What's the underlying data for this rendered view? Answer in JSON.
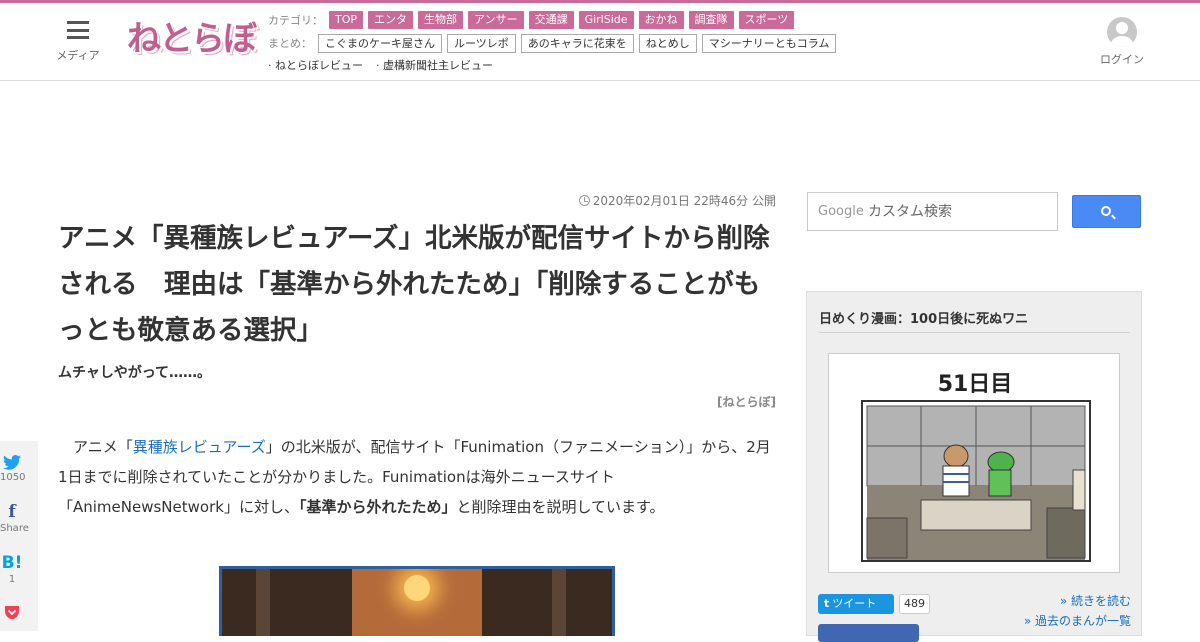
{
  "header": {
    "menu_label": "メディア",
    "logo_text": "ねとらぼ",
    "category_label": "カテゴリ：",
    "categories": [
      "TOP",
      "エンタ",
      "生物部",
      "アンサー",
      "交通課",
      "GirlSide",
      "おかね",
      "調査隊",
      "スポーツ"
    ],
    "summary_label": "まとめ：",
    "summaries": [
      "こぐまのケーキ屋さん",
      "ルーツレポ",
      "あのキャラに花束を",
      "ねとめし",
      "マシーナリーともコラム"
    ],
    "reviews": [
      "· ねとらぼレビュー",
      "· 虚構新聞社主レビュー"
    ],
    "login_label": "ログイン"
  },
  "article": {
    "date": "2020年02月01日 22時46分 公開",
    "title": "アニメ「異種族レビュアーズ」北米版が配信サイトから削除される　理由は「基準から外れたため」「削除することがもっとも敬意ある選択」",
    "subtitle": "ムチャしやがって……。",
    "byline": "[ねとらぼ]",
    "para_pre": "　アニメ「",
    "para_link": "異種族レビュアーズ",
    "para_mid": "」の北米版が、配信サイト「Funimation（ファニメーション）」から、2月1日までに削除されていたことが分かりました。Funimationは海外ニュースサイト「AnimeNewsNetwork」に対し、",
    "para_bold": "「基準から外れたため」",
    "para_post": "と削除理由を説明しています。"
  },
  "share": {
    "twitter_count": "1050",
    "facebook_label": "Share",
    "hatena_icon": "B!",
    "hatena_count": "1"
  },
  "search": {
    "google_label": "Google",
    "placeholder": "カスタム検索"
  },
  "widget": {
    "title": "日めくり漫画：100日後に死ぬワニ",
    "comic_day": "51日目",
    "tweet_label": "ツイート",
    "tweet_count": "489",
    "more_read": "» 続きを読む",
    "more_past": "» 過去のまんが一覧"
  },
  "colors": {
    "brand": "#c96a98",
    "link": "#1a6fbf",
    "search_button": "#4a8af4"
  },
  "icons": [
    "menu-icon",
    "clock-icon",
    "twitter-icon",
    "facebook-icon",
    "hatena-icon",
    "pocket-icon",
    "search-icon",
    "user-icon"
  ]
}
